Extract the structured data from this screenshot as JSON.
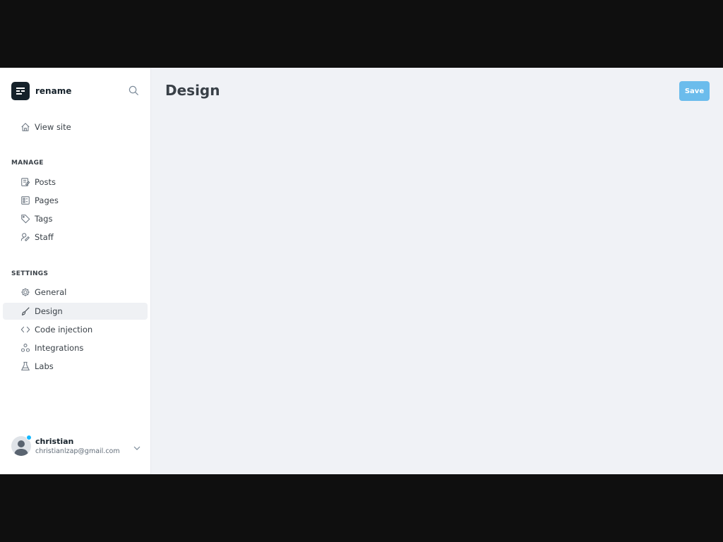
{
  "brand": {
    "name": "rename",
    "logo_icon": "ghost-logo-icon"
  },
  "sidebar": {
    "view_site": {
      "label": "View site",
      "icon": "home-icon"
    },
    "manage": {
      "heading": "MANAGE",
      "items": [
        {
          "label": "Posts",
          "icon": "posts-icon"
        },
        {
          "label": "Pages",
          "icon": "pages-icon"
        },
        {
          "label": "Tags",
          "icon": "tag-icon"
        },
        {
          "label": "Staff",
          "icon": "staff-icon"
        }
      ]
    },
    "settings": {
      "heading": "SETTINGS",
      "items": [
        {
          "label": "General",
          "icon": "gear-icon"
        },
        {
          "label": "Design",
          "icon": "brush-icon",
          "active": true
        },
        {
          "label": "Code injection",
          "icon": "code-icon"
        },
        {
          "label": "Integrations",
          "icon": "integrations-icon"
        },
        {
          "label": "Labs",
          "icon": "flask-icon"
        }
      ]
    }
  },
  "user": {
    "name": "christian",
    "email": "christianlzap@gmail.com",
    "status_color": "#14b8ff"
  },
  "main": {
    "title": "Design",
    "save_label": "Save"
  },
  "colors": {
    "accent": "#6bbcec",
    "sidebar_active": "#eff1f4",
    "main_bg": "#f0f2f6",
    "text": "#394047"
  }
}
